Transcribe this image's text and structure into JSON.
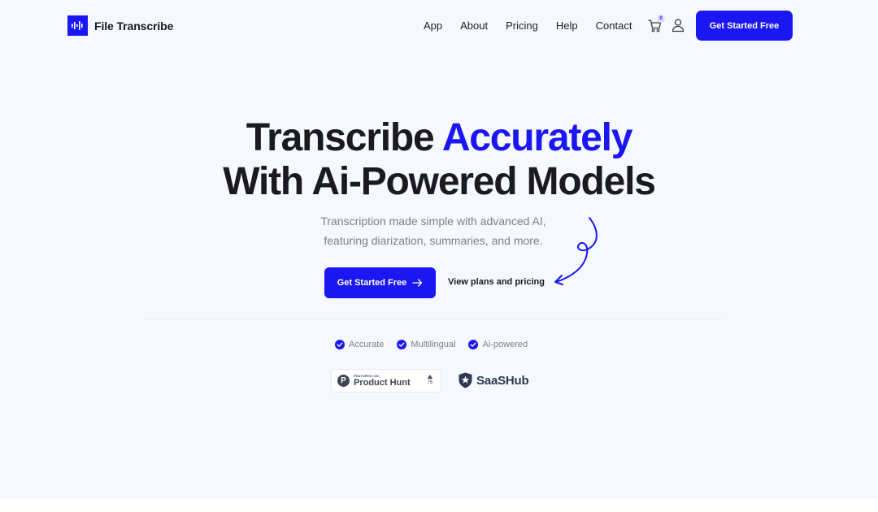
{
  "brand": {
    "name": "File Transcribe",
    "accent_color": "#1a17f2"
  },
  "nav": {
    "items": [
      {
        "label": "App"
      },
      {
        "label": "About"
      },
      {
        "label": "Pricing"
      },
      {
        "label": "Help"
      },
      {
        "label": "Contact"
      }
    ],
    "cart_count": "0",
    "cta_label": "Get Started Free"
  },
  "hero": {
    "title_part1": "Transcribe ",
    "title_accent": "Accurately",
    "title_line2": "With Ai-Powered Models",
    "subtitle_line1": "Transcription made simple with advanced AI,",
    "subtitle_line2": "featuring diarization, summaries, and more.",
    "cta_label": "Get Started Free",
    "secondary_link": "View plans and pricing"
  },
  "features": [
    {
      "label": "Accurate"
    },
    {
      "label": "Multilingual"
    },
    {
      "label": "Ai-powered"
    }
  ],
  "badges": {
    "product_hunt": {
      "featured": "FEATURED ON",
      "name": "Product Hunt",
      "votes": "75"
    },
    "saashub": {
      "name": "SaaSHub"
    }
  }
}
